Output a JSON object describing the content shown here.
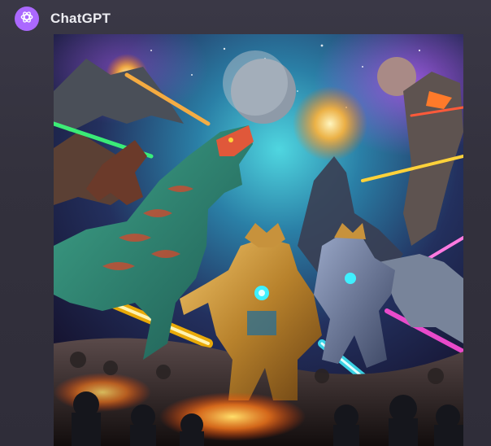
{
  "message": {
    "sender": "ChatGPT",
    "avatar_icon": "openai-logo-icon",
    "avatar_color": "#ab68ff"
  },
  "generated_image": {
    "kind": "ai-generated-image",
    "subject_icon": "dinosaur-battle-artwork"
  },
  "colors": {
    "background": "#34323f",
    "text": "#ececf1"
  }
}
